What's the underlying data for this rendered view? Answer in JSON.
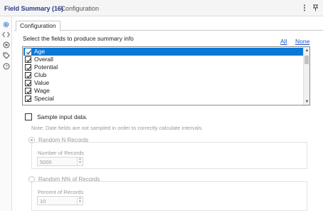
{
  "header": {
    "title": "Field Summary (16)",
    "subtitle": "- Configuration",
    "menu_icon": "more-vertical-icon",
    "pin_icon": "pin-icon"
  },
  "sidebar": {
    "icons": [
      "gear-icon",
      "code-icon",
      "circle-x-icon",
      "tag-icon",
      "help-icon"
    ]
  },
  "tabs": [
    {
      "label": "Configuration"
    }
  ],
  "config": {
    "fields_label": "Select the fields to produce summary info",
    "all_label": "All",
    "none_label": "None",
    "fields": [
      {
        "label": "Age",
        "checked": true,
        "selected": true
      },
      {
        "label": "Overall",
        "checked": true,
        "selected": false
      },
      {
        "label": "Potential",
        "checked": true,
        "selected": false
      },
      {
        "label": "Club",
        "checked": true,
        "selected": false
      },
      {
        "label": "Value",
        "checked": true,
        "selected": false
      },
      {
        "label": "Wage",
        "checked": true,
        "selected": false
      },
      {
        "label": "Special",
        "checked": true,
        "selected": false
      }
    ],
    "sample_label": "Sample input data.",
    "sample_checked": false,
    "note": "Note: Date fields are not sampled in order to correctly calculate intervals.",
    "random_n": {
      "label": "Random N Records",
      "field_label": "Number of Records",
      "value": "5000"
    },
    "random_pct": {
      "label": "Random N% of Records",
      "field_label": "Percent of Records",
      "value": "10"
    }
  },
  "colors": {
    "accent": "#0b78d7",
    "title": "#2b3a8c",
    "link": "#1a56d6"
  }
}
